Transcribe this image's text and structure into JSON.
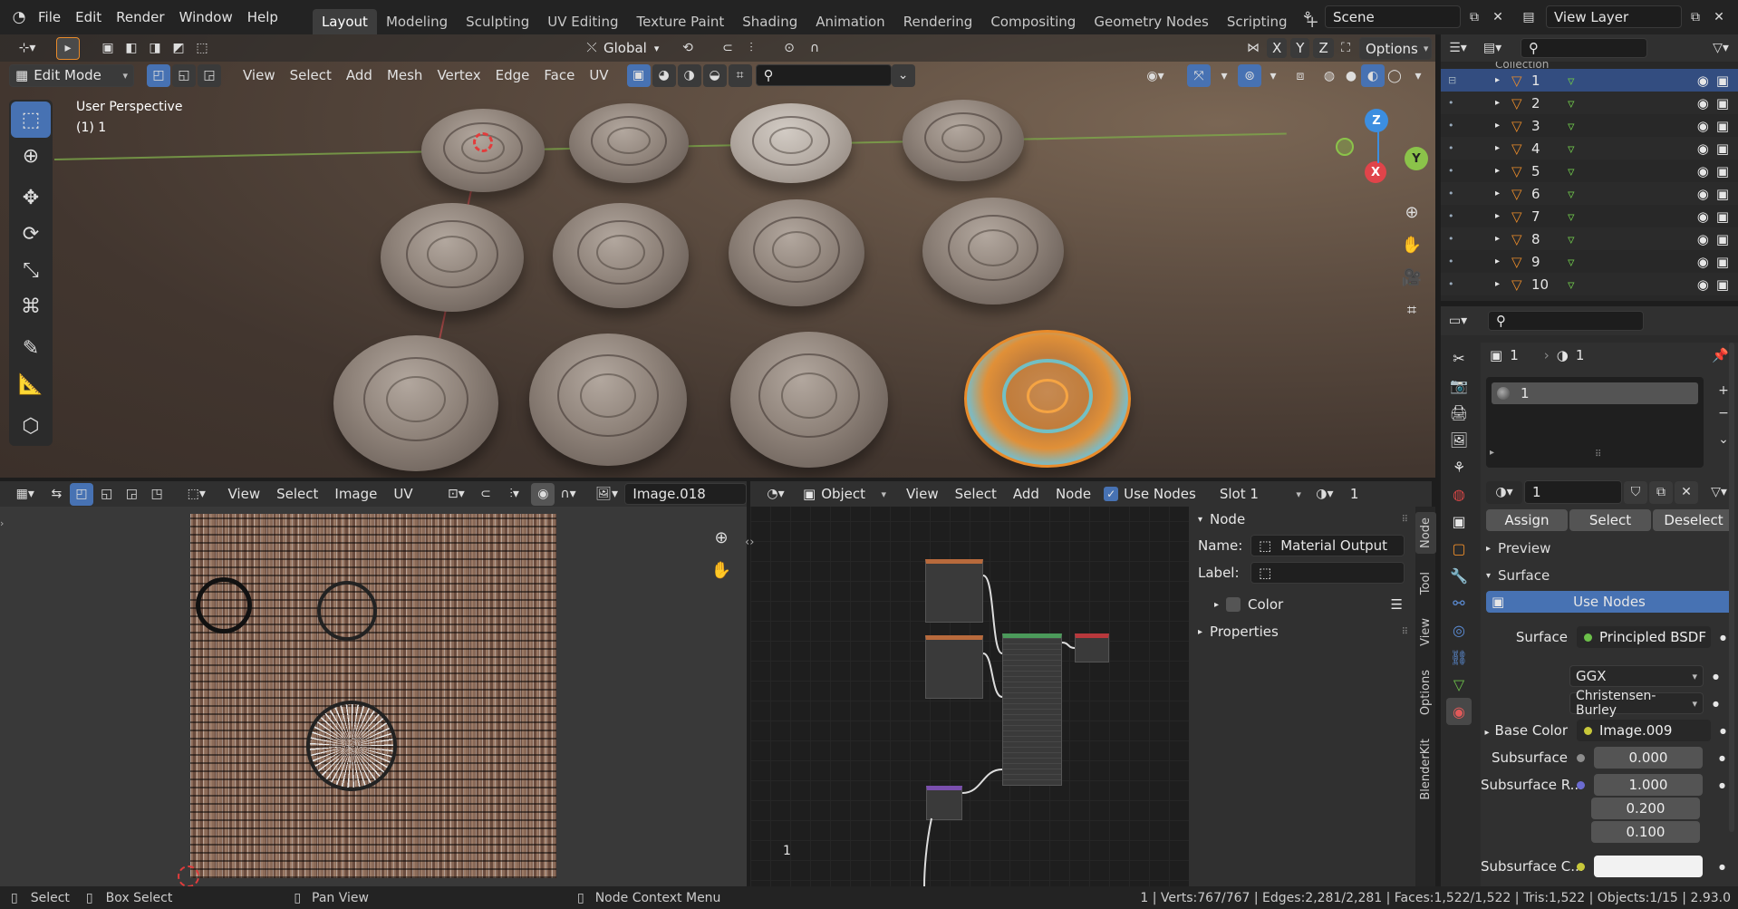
{
  "menu": {
    "file": "File",
    "edit": "Edit",
    "render": "Render",
    "window": "Window",
    "help": "Help"
  },
  "workspaces": [
    "Layout",
    "Modeling",
    "Sculpting",
    "UV Editing",
    "Texture Paint",
    "Shading",
    "Animation",
    "Rendering",
    "Compositing",
    "Geometry Nodes",
    "Scripting"
  ],
  "scene": {
    "name": "Scene",
    "view_layer": "View Layer"
  },
  "viewport_header": {
    "transform": "Global",
    "options": "Options",
    "mode": "Edit Mode",
    "menus": [
      "View",
      "Select",
      "Add",
      "Mesh",
      "Vertex",
      "Edge",
      "Face",
      "UV"
    ],
    "axes": [
      "X",
      "Y",
      "Z"
    ]
  },
  "viewport": {
    "title": "User Perspective",
    "subtitle": "(1) 1",
    "gizmo": {
      "x": "X",
      "y": "Y",
      "z": "Z"
    }
  },
  "outliner": {
    "collection": "Collection",
    "items": [
      "1",
      "2",
      "3",
      "4",
      "5",
      "6",
      "7",
      "8",
      "9",
      "10"
    ]
  },
  "properties": {
    "obj_count": "1",
    "mat_count": "1",
    "slot_name": "1",
    "material_name": "1",
    "assign": "Assign",
    "select": "Select",
    "deselect": "Deselect",
    "preview": "Preview",
    "surface": "Surface",
    "use_nodes": "Use Nodes",
    "surface_label": "Surface",
    "surface_value": "Principled BSDF",
    "distribution": "GGX",
    "sss_method": "Christensen-Burley",
    "base_color_label": "Base Color",
    "base_color_value": "Image.009",
    "subsurface_label": "Subsurface",
    "subsurface_value": "0.000",
    "subsurface_r_label": "Subsurface R...",
    "subsurface_r": [
      "1.000",
      "0.200",
      "0.100"
    ],
    "subsurface_c_label": "Subsurface C..."
  },
  "uv_editor": {
    "menus": [
      "View",
      "Select",
      "Image",
      "UV"
    ],
    "image": "Image.018"
  },
  "node_editor": {
    "type": "Object",
    "menus": [
      "View",
      "Select",
      "Add",
      "Node"
    ],
    "use_nodes": "Use Nodes",
    "slot": "Slot 1",
    "mat": "1",
    "corner_label": "1"
  },
  "node_panel": {
    "title": "Node",
    "name_label": "Name:",
    "name_value": "Material Output",
    "label_label": "Label:",
    "color": "Color",
    "properties": "Properties",
    "tabs": [
      "Node",
      "Tool",
      "View",
      "Options",
      "BlenderKit"
    ]
  },
  "statusbar": {
    "select": "Select",
    "box_select": "Box Select",
    "pan_view": "Pan View",
    "node_menu": "Node Context Menu",
    "stats": "1 | Verts:767/767 | Edges:2,281/2,281 | Faces:1,522/1,522 | Tris:1,522 | Objects:1/15 | 2.93.0"
  },
  "colors": {
    "accent": "#4772b3",
    "axis_x": "#e0444a",
    "axis_y": "#8bc34a",
    "axis_z": "#3c8ee0",
    "selection": "#e98b2a"
  }
}
